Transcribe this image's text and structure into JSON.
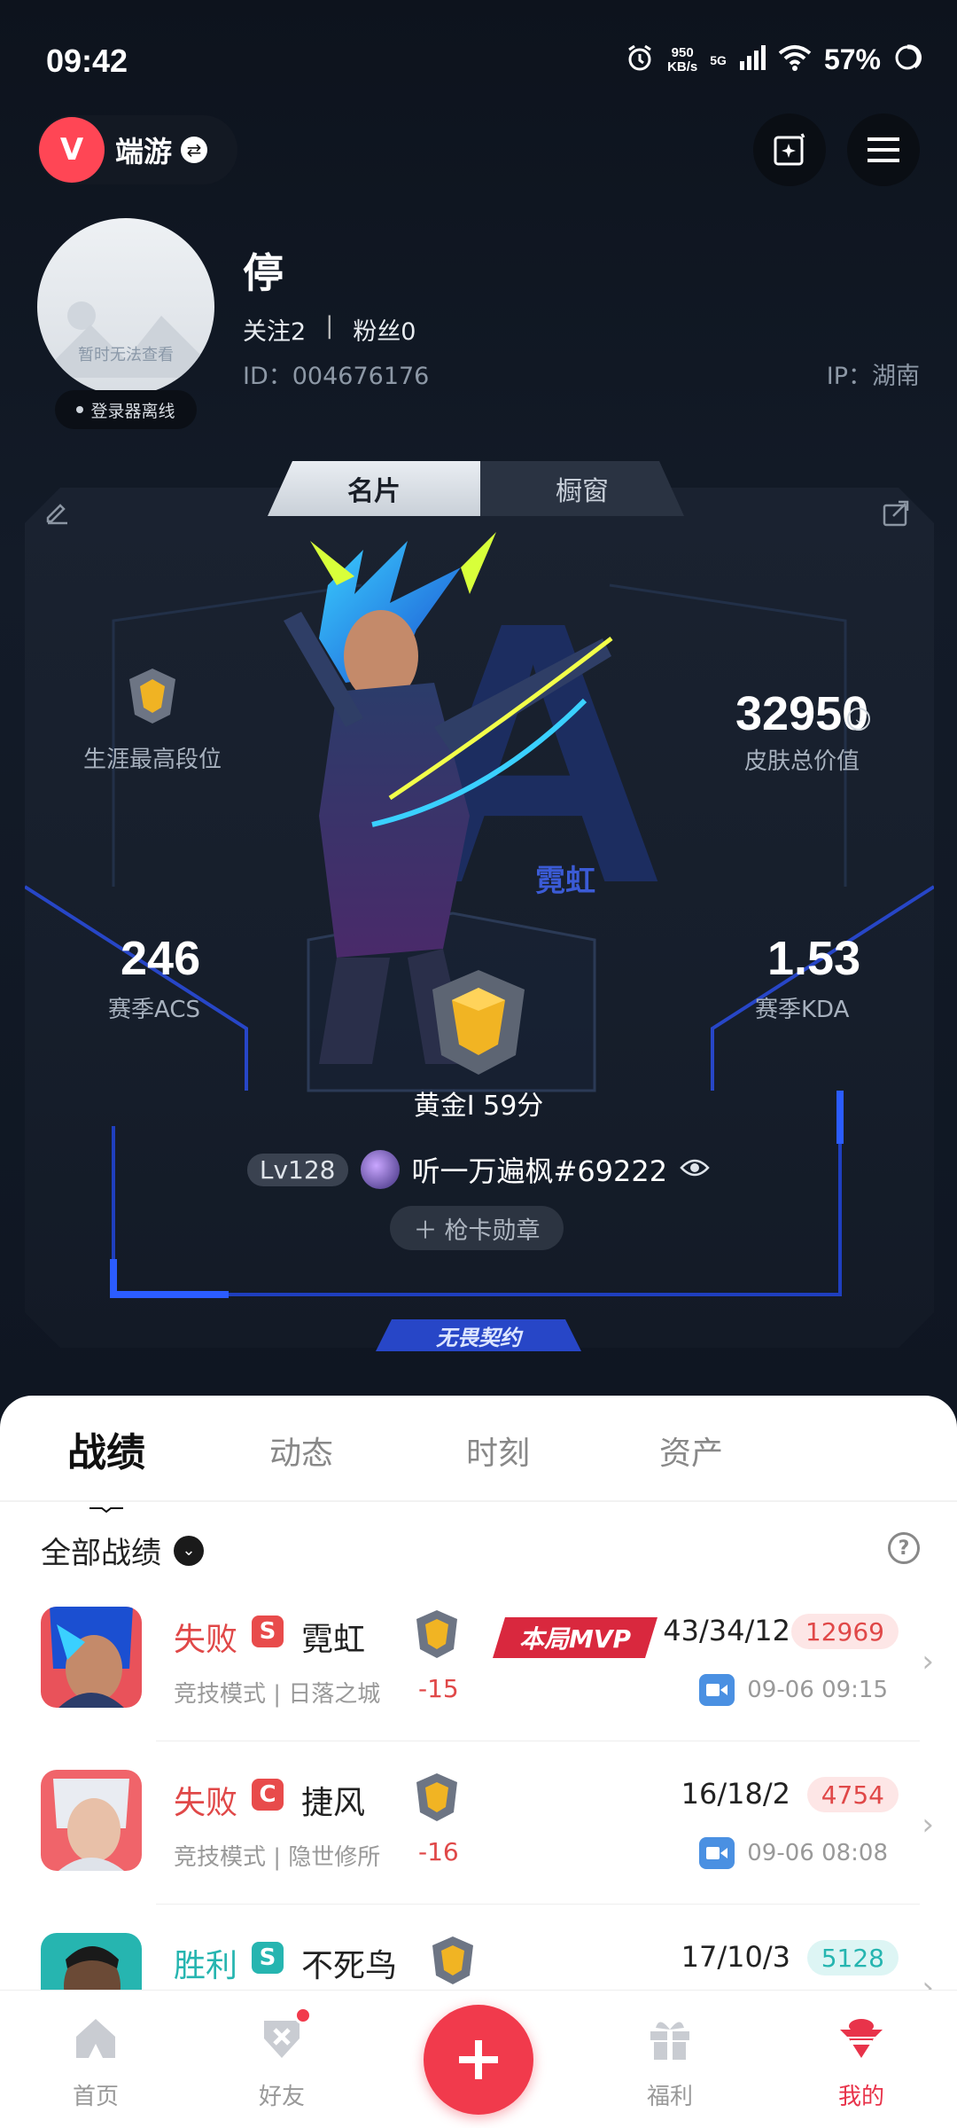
{
  "status_bar": {
    "time": "09:42",
    "net_speed_value": "950",
    "net_speed_unit": "KB/s",
    "network": "5G",
    "battery": "57%"
  },
  "header": {
    "brand_text": "端游"
  },
  "profile": {
    "name": "停",
    "following_label": "关注",
    "following_count": "2",
    "fans_label": "粉丝",
    "fans_count": "0",
    "id_text": "ID：004676176",
    "ip_text": "IP：湖南",
    "avatar_placeholder": "暂时无法查看",
    "status": "登录器离线"
  },
  "card": {
    "tabs": [
      "名片",
      "橱窗"
    ],
    "active_tab": 0,
    "career_rank_label": "生涯最高段位",
    "skin_value": "32950",
    "skin_value_label": "皮肤总价值",
    "acs_value": "246",
    "acs_label": "赛季ACS",
    "kda_value": "1.53",
    "kda_label": "赛季KDA",
    "agent_name": "霓虹",
    "rank_text": "黄金I 59分",
    "level": "Lv128",
    "player_name": "听一万遍枫#69222",
    "medal_button": "枪卡勋章",
    "contract_label": "无畏契约"
  },
  "panel": {
    "tabs": [
      "战绩",
      "动态",
      "时刻",
      "资产"
    ],
    "active_tab": 0,
    "filter_label": "全部战绩",
    "matches": [
      {
        "result": "失败",
        "result_color": "#e04848",
        "badge": "S",
        "badge_color": "#e84b4b",
        "agent": "霓虹",
        "mode": "竞技模式 | 日落之城",
        "delta": "-15",
        "mvp": "本局MVP",
        "kda": "43/34/12",
        "score": "12969",
        "score_bg": "#fde6e6",
        "score_color": "#e04848",
        "time": "09-06 09:15"
      },
      {
        "result": "失败",
        "result_color": "#e04848",
        "badge": "C",
        "badge_color": "#e84b4b",
        "agent": "捷风",
        "mode": "竞技模式 | 隐世修所",
        "delta": "-16",
        "mvp": "",
        "kda": "16/18/2",
        "score": "4754",
        "score_bg": "#fde6e6",
        "score_color": "#e04848",
        "time": "09-06 08:08"
      },
      {
        "result": "胜利",
        "result_color": "#26b5b0",
        "badge": "S",
        "badge_color": "#26b5b0",
        "agent": "不死鸟",
        "mode": "",
        "delta": "",
        "mvp": "",
        "kda": "17/10/3",
        "score": "5128",
        "score_bg": "#ddf5f4",
        "score_color": "#26b5b0",
        "time": ""
      }
    ]
  },
  "nav": {
    "items": [
      "首页",
      "好友",
      "福利",
      "我的"
    ],
    "active": 3
  },
  "colors": {
    "accent": "#f13a4c",
    "card_blue": "#2746c7",
    "bg_dark": "#0f1520"
  }
}
